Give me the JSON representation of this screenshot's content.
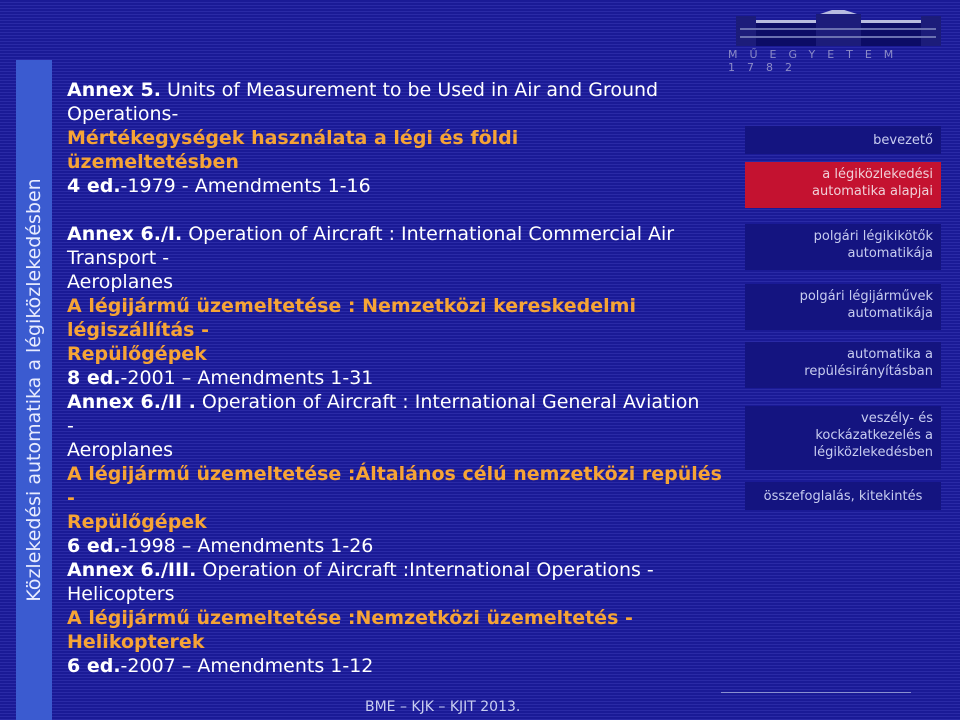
{
  "sidebar": {
    "title": "Közlekedési automatika a légiközlekedésben"
  },
  "logo": {
    "caption": "MŰEGYETEM 1782"
  },
  "main": {
    "lines": [
      [
        {
          "s": "b",
          "t": "Annex 5."
        },
        {
          "s": "n",
          "t": " Units of Measurement to be Used in Air and Ground"
        }
      ],
      [
        {
          "s": "n",
          "t": "Operations-"
        }
      ],
      [
        {
          "s": "o",
          "t": "Mértékegységek használata a légi és földi"
        }
      ],
      [
        {
          "s": "o",
          "t": "üzemeltetésben"
        }
      ],
      [
        {
          "s": "b",
          "t": "4 ed."
        },
        {
          "s": "n",
          "t": "-1979 - Amendments 1-16"
        }
      ],
      [],
      [
        {
          "s": "b",
          "t": "Annex 6./I."
        },
        {
          "s": "n",
          "t": " Operation of Aircraft : International Commercial Air"
        }
      ],
      [
        {
          "s": "n",
          "t": "Transport -"
        }
      ],
      [
        {
          "s": "n",
          "t": "Aeroplanes"
        }
      ],
      [
        {
          "s": "o",
          "t": "A légijármű üzemeltetése : Nemzetközi kereskedelmi"
        }
      ],
      [
        {
          "s": "o",
          "t": "légiszállítás -"
        }
      ],
      [
        {
          "s": "o",
          "t": "Repülőgépek"
        }
      ],
      [
        {
          "s": "b",
          "t": "8 ed."
        },
        {
          "s": "n",
          "t": "-2001 – Amendments 1-31"
        }
      ],
      [
        {
          "s": "b",
          "t": "Annex 6./II ."
        },
        {
          "s": "n",
          "t": " Operation of Aircraft : International General Aviation"
        }
      ],
      [
        {
          "s": "n",
          "t": "-"
        }
      ],
      [
        {
          "s": "n",
          "t": "Aeroplanes"
        }
      ],
      [
        {
          "s": "o",
          "t": "A légijármű üzemeltetése :Általános célú nemzetközi repülés"
        }
      ],
      [
        {
          "s": "o",
          "t": "-"
        }
      ],
      [
        {
          "s": "o",
          "t": "Repülőgépek"
        }
      ],
      [
        {
          "s": "b",
          "t": "6 ed."
        },
        {
          "s": "n",
          "t": "-1998 – Amendments 1-26"
        }
      ],
      [
        {
          "s": "b",
          "t": "Annex 6./III."
        },
        {
          "s": "n",
          "t": " Operation of Aircraft :International Operations -"
        }
      ],
      [
        {
          "s": "n",
          "t": "Helicopters"
        }
      ],
      [
        {
          "s": "o",
          "t": "A légijármű üzemeltetése :Nemzetközi üzemeltetés -"
        }
      ],
      [
        {
          "s": "o",
          "t": "Helikopterek"
        }
      ],
      [
        {
          "s": "b",
          "t": "6 ed."
        },
        {
          "s": "n",
          "t": "-2007 – Amendments 1-12"
        }
      ]
    ]
  },
  "nav": {
    "items": [
      {
        "label": "bevezető",
        "active": false
      },
      {
        "label": "a légiközlekedési automatika alapjai",
        "active": true
      },
      {
        "label": "polgári légikikötők automatikája",
        "active": false
      },
      {
        "label": "polgári légijárművek automatikája",
        "active": false
      },
      {
        "label": "automatika a repülésirányításban",
        "active": false
      },
      {
        "label": "veszély- és kockázatkezelés a légiközlekedésben",
        "active": false
      },
      {
        "label": "összefoglalás, kitekintés",
        "active": false
      }
    ]
  },
  "footer": {
    "text": "BME – KJK – KJIT 2013."
  },
  "colors": {
    "background": "#1a1a96",
    "accent_text": "#f6a436",
    "active_nav": "#c41230",
    "sidebar": "#3b5bd0"
  }
}
